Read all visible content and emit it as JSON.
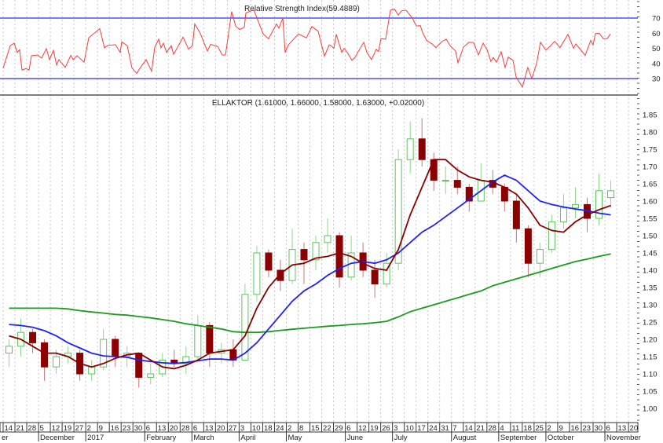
{
  "chart_data": [
    {
      "type": "line",
      "title": "Relative Strength Index",
      "value_label": "(59.4889)",
      "ylim": [
        20,
        80
      ],
      "yticks": [
        30,
        40,
        50,
        60,
        70
      ],
      "bands": [
        30,
        70
      ],
      "colors": {
        "line": "#ff3b3b",
        "band": "#2b2bff"
      },
      "x_unit": "week index from 14 Nov 2016",
      "points": [
        [
          0,
          36.9
        ],
        [
          0.6,
          51.7
        ],
        [
          0.93,
          53.4
        ],
        [
          1.2,
          47.3
        ],
        [
          1.4,
          49.1
        ],
        [
          1.6,
          35.6
        ],
        [
          1.93,
          36.6
        ],
        [
          2.2,
          35.6
        ],
        [
          2.4,
          45.1
        ],
        [
          2.93,
          45.6
        ],
        [
          3.26,
          43.5
        ],
        [
          3.66,
          49.8
        ],
        [
          3.93,
          42.5
        ],
        [
          4.26,
          48.6
        ],
        [
          4.53,
          39
        ],
        [
          4.73,
          42.5
        ],
        [
          5.26,
          37.3
        ],
        [
          5.73,
          45.3
        ],
        [
          5.93,
          42.5
        ],
        [
          6.26,
          45.1
        ],
        [
          6.86,
          40.8
        ],
        [
          7.26,
          57
        ],
        [
          8.19,
          63
        ],
        [
          8.59,
          50.3
        ],
        [
          8.86,
          51.9
        ],
        [
          9.52,
          52.4
        ],
        [
          9.92,
          47.3
        ],
        [
          10.05,
          54.3
        ],
        [
          10.52,
          51.7
        ],
        [
          10.92,
          36.9
        ],
        [
          11.32,
          33.5
        ],
        [
          11.58,
          36.6
        ],
        [
          12.12,
          42.5
        ],
        [
          12.58,
          34.8
        ],
        [
          12.85,
          50.8
        ],
        [
          13.18,
          56
        ],
        [
          13.38,
          50.3
        ],
        [
          13.58,
          53.4
        ],
        [
          13.85,
          47.3
        ],
        [
          14.25,
          51.7
        ],
        [
          14.45,
          46
        ],
        [
          15.25,
          57.4
        ],
        [
          15.71,
          49.4
        ],
        [
          16.05,
          51.9
        ],
        [
          16.24,
          66.1
        ],
        [
          16.71,
          59.8
        ],
        [
          17.31,
          48.2
        ],
        [
          17.58,
          52.6
        ],
        [
          18.18,
          51.2
        ],
        [
          18.57,
          45.6
        ],
        [
          18.84,
          45.6
        ],
        [
          18.97,
          52.2
        ],
        [
          19.37,
          74.3
        ],
        [
          19.71,
          64.7
        ],
        [
          20.04,
          62.4
        ],
        [
          20.44,
          63.9
        ],
        [
          20.57,
          73.4
        ],
        [
          21.24,
          75.5
        ],
        [
          22.04,
          59.5
        ],
        [
          22.5,
          56.4
        ],
        [
          23.17,
          66.1
        ],
        [
          23.37,
          63.3
        ],
        [
          23.7,
          70
        ],
        [
          23.9,
          47.3
        ],
        [
          24.17,
          52.2
        ],
        [
          25.03,
          59.5
        ],
        [
          25.7,
          56.9
        ],
        [
          26.17,
          64.4
        ],
        [
          26.7,
          61.3
        ],
        [
          27.23,
          44.8
        ],
        [
          27.63,
          52.2
        ],
        [
          27.7,
          52.2
        ],
        [
          28.03,
          50
        ],
        [
          28.23,
          59.2
        ],
        [
          28.7,
          47.3
        ],
        [
          28.9,
          50
        ],
        [
          29.23,
          46.5
        ],
        [
          29.56,
          42.1
        ],
        [
          29.83,
          44.2
        ],
        [
          30.56,
          54
        ],
        [
          30.83,
          47.3
        ],
        [
          31.22,
          42.5
        ],
        [
          31.62,
          49.4
        ],
        [
          31.82,
          47.9
        ],
        [
          32.02,
          56.4
        ],
        [
          32.42,
          56
        ],
        [
          32.82,
          75.2
        ],
        [
          33.16,
          76
        ],
        [
          33.49,
          72
        ],
        [
          33.76,
          74.8
        ],
        [
          34.15,
          75.2
        ],
        [
          34.69,
          70
        ],
        [
          35.02,
          64.7
        ],
        [
          35.35,
          65
        ],
        [
          35.55,
          60.4
        ],
        [
          35.89,
          55.2
        ],
        [
          36.35,
          52.9
        ],
        [
          36.68,
          50.5
        ],
        [
          37.22,
          54.6
        ],
        [
          37.55,
          56
        ],
        [
          37.88,
          51.7
        ],
        [
          38.35,
          48.2
        ],
        [
          38.55,
          40.4
        ],
        [
          39.01,
          50.8
        ],
        [
          39.48,
          54
        ],
        [
          39.88,
          53.8
        ],
        [
          40.28,
          45.6
        ],
        [
          40.68,
          53.4
        ],
        [
          41.01,
          49.1
        ],
        [
          41.34,
          41.3
        ],
        [
          41.54,
          43.9
        ],
        [
          41.81,
          40.8
        ],
        [
          42.21,
          47.7
        ],
        [
          42.54,
          37.3
        ],
        [
          42.81,
          44.2
        ],
        [
          43.21,
          42.1
        ],
        [
          43.48,
          30.9
        ],
        [
          44.01,
          24.4
        ],
        [
          44.47,
          37.3
        ],
        [
          44.81,
          30
        ],
        [
          45.21,
          40
        ],
        [
          45.54,
          54
        ],
        [
          46.0,
          48.8
        ],
        [
          46.34,
          51.2
        ],
        [
          46.74,
          54.6
        ],
        [
          47.2,
          50.5
        ],
        [
          47.87,
          59.2
        ],
        [
          48.34,
          50
        ],
        [
          48.54,
          52.9
        ],
        [
          49.33,
          45.3
        ],
        [
          49.8,
          55.2
        ],
        [
          50.0,
          52.2
        ],
        [
          50.2,
          59.8
        ],
        [
          50.53,
          59.8
        ],
        [
          50.87,
          56.4
        ],
        [
          51.2,
          56.4
        ],
        [
          51.46,
          59.5
        ]
      ]
    },
    {
      "type": "candlestick",
      "title": "ELLAKTOR (1.61000, 1.66000, 1.58000, 1.63000, +0.02000)",
      "ylim": [
        0.975,
        1.88
      ],
      "yticks": [
        "1.85",
        "1.80",
        "1.75",
        "1.70",
        "1.65",
        "1.60",
        "1.55",
        "1.50",
        "1.45",
        "1.40",
        "1.35",
        "1.30",
        "1.25",
        "1.20",
        "1.15",
        "1.10",
        "1.05",
        "1.00"
      ],
      "colors": {
        "up": "#5fc25f",
        "down": "#8b0000",
        "ma_short": "#8b0000",
        "ma_mid": "#1f1fff",
        "ma_long": "#1e9a1e"
      },
      "ohlc_weekly": [
        [
          1.16,
          1.2,
          1.12,
          1.18
        ],
        [
          1.18,
          1.26,
          1.15,
          1.22
        ],
        [
          1.22,
          1.23,
          1.16,
          1.19
        ],
        [
          1.19,
          1.2,
          1.08,
          1.12
        ],
        [
          1.12,
          1.17,
          1.1,
          1.15
        ],
        [
          1.15,
          1.18,
          1.13,
          1.16
        ],
        [
          1.16,
          1.17,
          1.08,
          1.1
        ],
        [
          1.1,
          1.14,
          1.08,
          1.12
        ],
        [
          1.12,
          1.23,
          1.11,
          1.2
        ],
        [
          1.2,
          1.21,
          1.12,
          1.15
        ],
        [
          1.15,
          1.18,
          1.12,
          1.16
        ],
        [
          1.16,
          1.16,
          1.06,
          1.09
        ],
        [
          1.09,
          1.13,
          1.07,
          1.1
        ],
        [
          1.1,
          1.16,
          1.09,
          1.14
        ],
        [
          1.14,
          1.17,
          1.12,
          1.13
        ],
        [
          1.13,
          1.18,
          1.1,
          1.15
        ],
        [
          1.15,
          1.27,
          1.14,
          1.24
        ],
        [
          1.24,
          1.25,
          1.12,
          1.16
        ],
        [
          1.16,
          1.19,
          1.13,
          1.17
        ],
        [
          1.17,
          1.2,
          1.12,
          1.14
        ],
        [
          1.14,
          1.36,
          1.14,
          1.33
        ],
        [
          1.33,
          1.47,
          1.31,
          1.45
        ],
        [
          1.45,
          1.46,
          1.38,
          1.4
        ],
        [
          1.4,
          1.43,
          1.34,
          1.37
        ],
        [
          1.37,
          1.52,
          1.36,
          1.46
        ],
        [
          1.46,
          1.48,
          1.36,
          1.43
        ],
        [
          1.43,
          1.5,
          1.4,
          1.48
        ],
        [
          1.48,
          1.55,
          1.45,
          1.5
        ],
        [
          1.5,
          1.51,
          1.35,
          1.38
        ],
        [
          1.38,
          1.5,
          1.37,
          1.45
        ],
        [
          1.45,
          1.48,
          1.38,
          1.4
        ],
        [
          1.4,
          1.43,
          1.32,
          1.36
        ],
        [
          1.36,
          1.45,
          1.35,
          1.42
        ],
        [
          1.42,
          1.75,
          1.4,
          1.72
        ],
        [
          1.72,
          1.83,
          1.68,
          1.78
        ],
        [
          1.78,
          1.84,
          1.7,
          1.72
        ],
        [
          1.72,
          1.74,
          1.63,
          1.66
        ],
        [
          1.66,
          1.7,
          1.62,
          1.66
        ],
        [
          1.66,
          1.7,
          1.62,
          1.64
        ],
        [
          1.64,
          1.65,
          1.57,
          1.6
        ],
        [
          1.6,
          1.71,
          1.6,
          1.66
        ],
        [
          1.66,
          1.69,
          1.62,
          1.64
        ],
        [
          1.64,
          1.65,
          1.57,
          1.6
        ],
        [
          1.6,
          1.62,
          1.48,
          1.52
        ],
        [
          1.52,
          1.53,
          1.38,
          1.42
        ],
        [
          1.42,
          1.48,
          1.38,
          1.46
        ],
        [
          1.46,
          1.56,
          1.45,
          1.54
        ],
        [
          1.54,
          1.62,
          1.52,
          1.58
        ],
        [
          1.58,
          1.64,
          1.55,
          1.59
        ],
        [
          1.59,
          1.61,
          1.51,
          1.55
        ],
        [
          1.55,
          1.68,
          1.53,
          1.63
        ],
        [
          1.61,
          1.66,
          1.58,
          1.63
        ]
      ],
      "ma_short": [
        1.21,
        1.2,
        1.18,
        1.16,
        1.16,
        1.15,
        1.13,
        1.12,
        1.13,
        1.145,
        1.155,
        1.16,
        1.14,
        1.12,
        1.115,
        1.125,
        1.14,
        1.16,
        1.165,
        1.17,
        1.21,
        1.29,
        1.35,
        1.39,
        1.415,
        1.42,
        1.435,
        1.44,
        1.45,
        1.44,
        1.42,
        1.405,
        1.4,
        1.46,
        1.56,
        1.64,
        1.72,
        1.72,
        1.69,
        1.67,
        1.66,
        1.655,
        1.64,
        1.62,
        1.58,
        1.53,
        1.515,
        1.51,
        1.54,
        1.56,
        1.575,
        1.587
      ],
      "ma_mid": [
        1.243,
        1.24,
        1.235,
        1.225,
        1.21,
        1.19,
        1.175,
        1.16,
        1.152,
        1.15,
        1.148,
        1.14,
        1.136,
        1.132,
        1.13,
        1.133,
        1.138,
        1.143,
        1.143,
        1.14,
        1.16,
        1.19,
        1.23,
        1.27,
        1.31,
        1.34,
        1.36,
        1.385,
        1.405,
        1.42,
        1.425,
        1.42,
        1.43,
        1.45,
        1.48,
        1.51,
        1.53,
        1.555,
        1.58,
        1.605,
        1.63,
        1.655,
        1.675,
        1.66,
        1.63,
        1.6,
        1.59,
        1.583,
        1.577,
        1.572,
        1.565,
        1.56
      ],
      "ma_long": [
        1.29,
        1.29,
        1.29,
        1.29,
        1.29,
        1.288,
        1.283,
        1.279,
        1.276,
        1.272,
        1.27,
        1.266,
        1.262,
        1.257,
        1.252,
        1.245,
        1.24,
        1.235,
        1.23,
        1.222,
        1.22,
        1.22,
        1.222,
        1.226,
        1.229,
        1.232,
        1.235,
        1.238,
        1.24,
        1.243,
        1.245,
        1.248,
        1.252,
        1.265,
        1.28,
        1.29,
        1.3,
        1.31,
        1.32,
        1.33,
        1.34,
        1.355,
        1.365,
        1.375,
        1.385,
        1.395,
        1.405,
        1.415,
        1.425,
        1.432,
        1.44,
        1.447
      ]
    }
  ],
  "x_axis": {
    "week_labels": [
      "14",
      "21",
      "28",
      "5",
      "12",
      "19",
      "27",
      "2",
      "9",
      "16",
      "23",
      "30",
      "6",
      "13",
      "20",
      "28",
      "6",
      "13",
      "20",
      "27",
      "3",
      "10",
      "18",
      "24",
      "2",
      "8",
      "15",
      "22",
      "29",
      "6",
      "12",
      "19",
      "26",
      "3",
      "10",
      "17",
      "24",
      "31",
      "7",
      "14",
      "21",
      "28",
      "4",
      "11",
      "18",
      "25",
      "2",
      "9",
      "16",
      "23",
      "30",
      "6",
      "13",
      "20"
    ],
    "months": [
      {
        "label": "er",
        "week": 0
      },
      {
        "label": "December",
        "week": 3
      },
      {
        "label": "2017",
        "week": 7
      },
      {
        "label": "February",
        "week": 12
      },
      {
        "label": "March",
        "week": 16
      },
      {
        "label": "April",
        "week": 20
      },
      {
        "label": "May",
        "week": 24
      },
      {
        "label": "June",
        "week": 29
      },
      {
        "label": "July",
        "week": 33
      },
      {
        "label": "August",
        "week": 38
      },
      {
        "label": "September",
        "week": 42
      },
      {
        "label": "October",
        "week": 46
      },
      {
        "label": "November",
        "week": 51
      }
    ]
  }
}
